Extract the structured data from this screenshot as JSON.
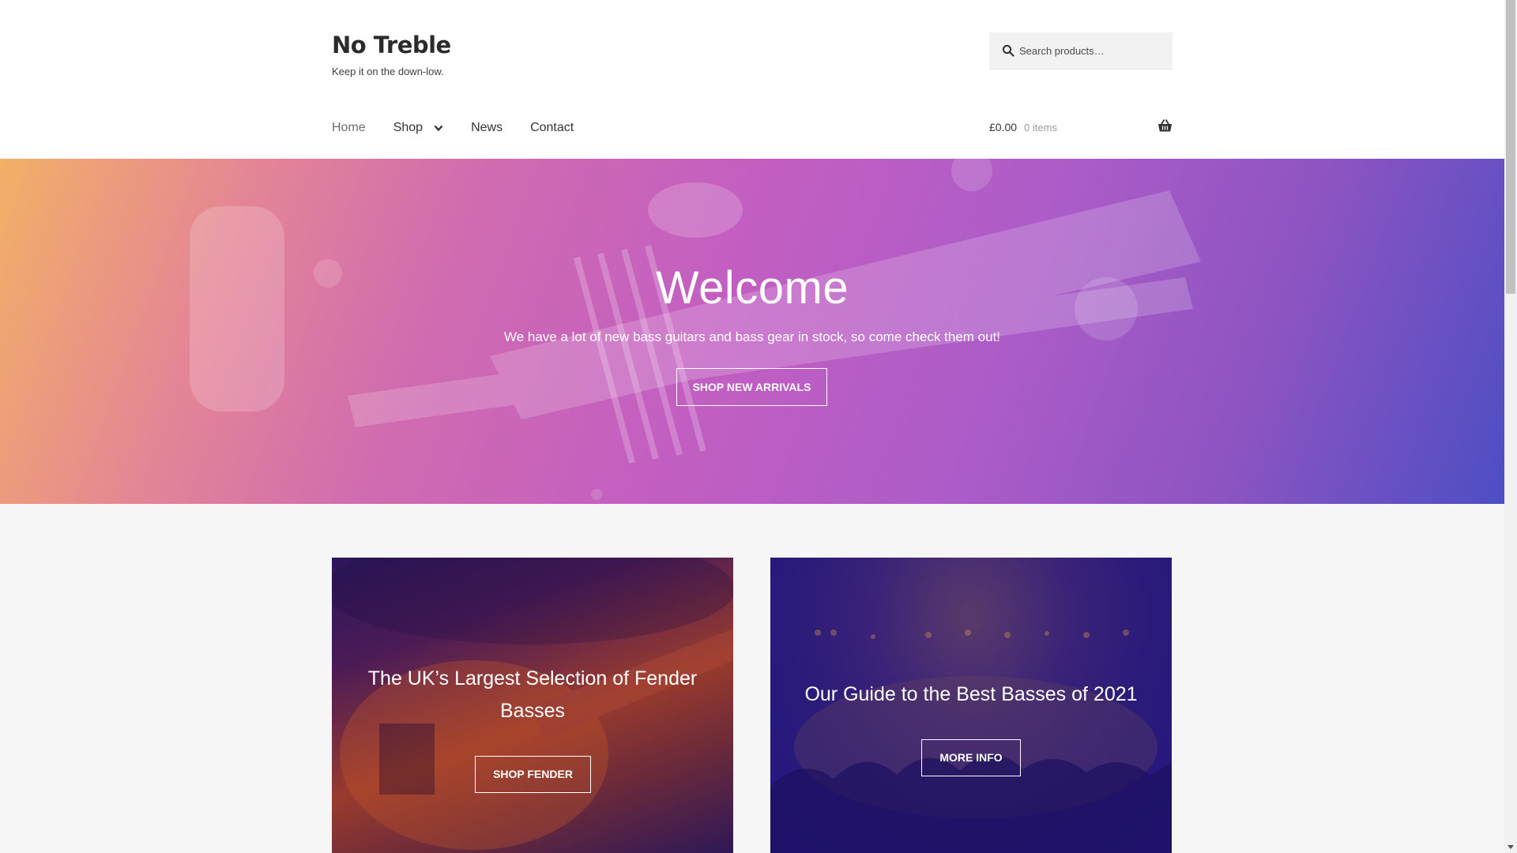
{
  "site": {
    "title": "No Treble",
    "tagline": "Keep it on the down-low."
  },
  "search": {
    "placeholder": "Search products…",
    "icon": "search-icon"
  },
  "nav": {
    "items": [
      {
        "label": "Home"
      },
      {
        "label": "Shop"
      },
      {
        "label": "News"
      },
      {
        "label": "Contact"
      }
    ]
  },
  "cart": {
    "amount": "£0.00",
    "count": "0 items",
    "icon": "basket-icon"
  },
  "hero": {
    "title": "Welcome",
    "subtitle": "We have a lot of new bass guitars and bass gear in stock, so come check them out!",
    "button": "SHOP NEW ARRIVALS"
  },
  "cards": [
    {
      "title": "The UK’s Largest Selection of Fender Basses",
      "button": "SHOP FENDER"
    },
    {
      "title": "Our Guide to the Best Basses of 2021",
      "button": "MORE INFO"
    }
  ],
  "colors": {
    "accent": "#c25ec2",
    "header_bg": "#ffffff",
    "body_bg": "#f6f6f6"
  }
}
